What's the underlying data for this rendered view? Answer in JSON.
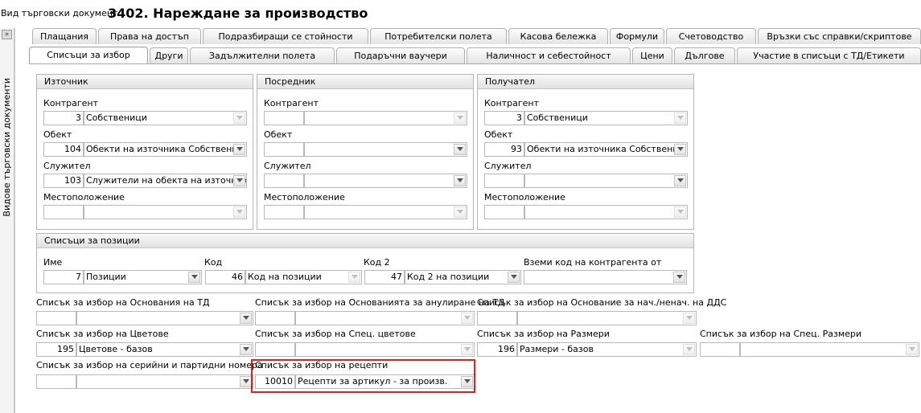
{
  "header": {
    "label": "Вид търговски документ:",
    "title": "3402. Нареждане за производство"
  },
  "sidebar": {
    "toggle": "»",
    "vertical_label": "Видове търговски документи"
  },
  "tabs_row1": [
    "Плащания",
    "Права на достъп",
    "Подразбиращи се стойности",
    "Потребителски полета",
    "Касова бележка",
    "Формули",
    "Счетоводство",
    "Връзки със справки/скриптове"
  ],
  "tabs_row2": [
    "Списъци за избор",
    "Други",
    "Задължителни полета",
    "Подаръчни ваучери",
    "Наличност и себестойност",
    "Цени",
    "Дългове",
    "Участие в списъци с ТД/Етикети"
  ],
  "active_tab": "Списъци за избор",
  "groups": {
    "source": {
      "title": "Източник",
      "contragent": {
        "label": "Контрагент",
        "code": "3",
        "name": "Собственици"
      },
      "object": {
        "label": "Обект",
        "code": "104",
        "name": "Обекти на източника Собственик (с"
      },
      "employee": {
        "label": "Служител",
        "code": "103",
        "name": "Служители на обекта на източника"
      },
      "location": {
        "label": "Местоположение",
        "code": "",
        "name": ""
      }
    },
    "intermediary": {
      "title": "Посредник",
      "contragent": {
        "label": "Контрагент",
        "code": "",
        "name": ""
      },
      "object": {
        "label": "Обект",
        "code": "",
        "name": ""
      },
      "employee": {
        "label": "Служител",
        "code": "",
        "name": ""
      },
      "location": {
        "label": "Местоположение",
        "code": "",
        "name": ""
      }
    },
    "recipient": {
      "title": "Получател",
      "contragent": {
        "label": "Контрагент",
        "code": "3",
        "name": "Собственици"
      },
      "object": {
        "label": "Обект",
        "code": "93",
        "name": "Обекти на източника Собственик (с"
      },
      "employee": {
        "label": "Служител",
        "code": "",
        "name": ""
      },
      "location": {
        "label": "Местоположение",
        "code": "",
        "name": ""
      }
    },
    "positions": {
      "title": "Списъци за позиции",
      "name": {
        "label": "Име",
        "code": "7",
        "value": "Позиции"
      },
      "code": {
        "label": "Код",
        "code": "46",
        "value": "Код на позиции"
      },
      "code2": {
        "label": "Код 2",
        "code": "47",
        "value": "Код 2 на позиции"
      },
      "contragent_code_from": {
        "label": "Вземи код на контрагента от",
        "value": ""
      }
    }
  },
  "lists": {
    "td_reasons": {
      "label": "Списък за избор на Основания на ТД",
      "code": "",
      "value": ""
    },
    "cancel_reasons": {
      "label": "Списък за избор на Основанията за анулиране на ТД",
      "code": "",
      "value": ""
    },
    "vat_reasons": {
      "label": "Списък за избор на Основание за нач./ненач. на ДДС",
      "code": "",
      "value": ""
    },
    "colors": {
      "label": "Списък за избор на Цветове",
      "code": "195",
      "value": "Цветове - базов"
    },
    "spec_colors": {
      "label": "Списък за избор на Спец. цветове",
      "code": "",
      "value": ""
    },
    "sizes": {
      "label": "Списък за избор на Размери",
      "code": "196",
      "value": "Размери - базов"
    },
    "spec_sizes": {
      "label": "Списък за избор на Спец. Размери",
      "code": "",
      "value": ""
    },
    "serials": {
      "label": "Списък за избор на серийни и партидни номера",
      "code": "",
      "value": ""
    },
    "recipes": {
      "label": "Списък за избор на рецепти",
      "code": "10010",
      "value": "Рецепти за артикул - за произв."
    }
  }
}
